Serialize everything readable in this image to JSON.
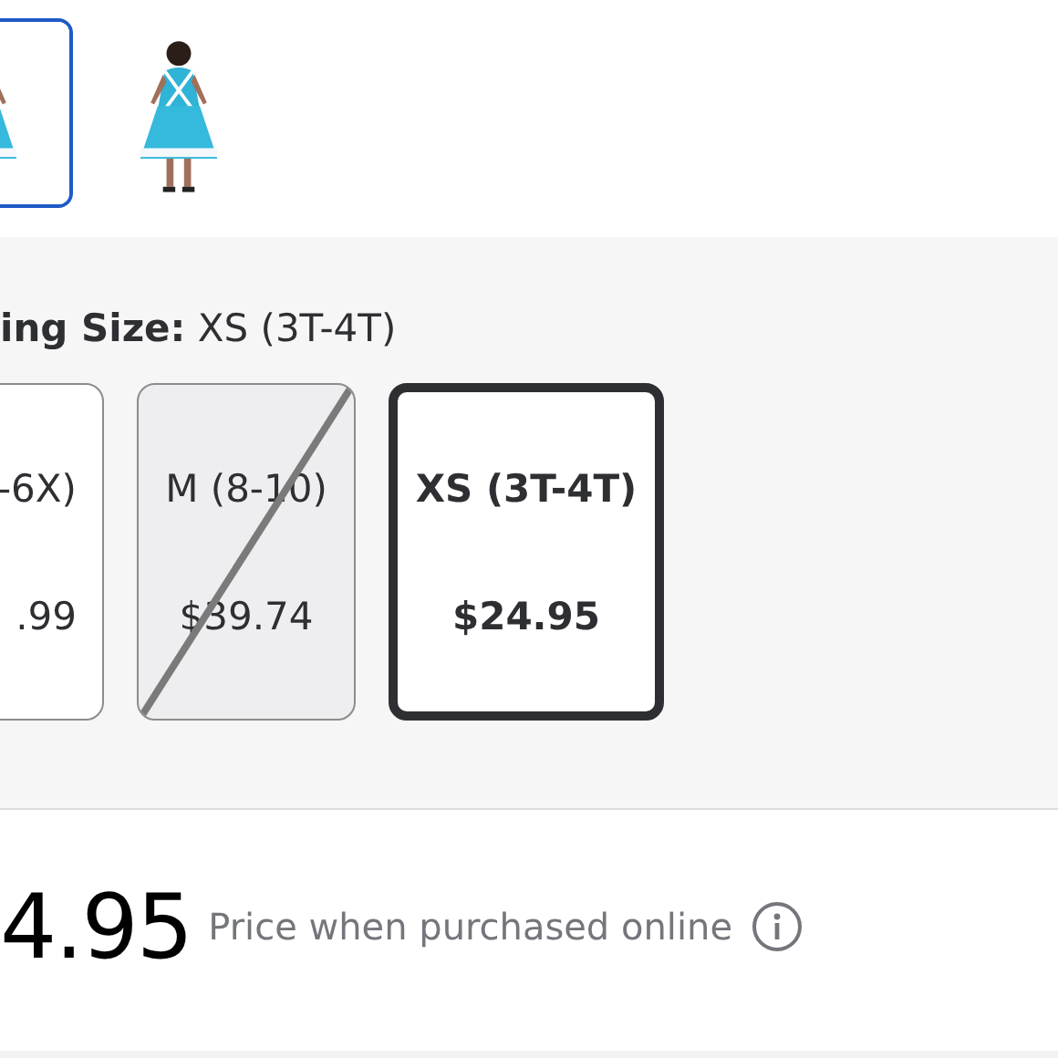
{
  "thumbnails": [
    {
      "kind": "picture",
      "selected": true
    },
    {
      "kind": "picture",
      "selected": false
    }
  ],
  "size_selector": {
    "label": "**ing Size:** XS (3T-4T)",
    "options": [
      {
        "label": "-6X)",
        "price": ".99",
        "selected": false,
        "disabled": false
      },
      {
        "label": "M (8-10)",
        "price": "$39.74",
        "selected": false,
        "disabled": true
      },
      {
        "label": "XS (3T-4T)",
        "price": "$24.95",
        "selected": true,
        "disabled": false
      }
    ]
  },
  "price": {
    "amount": "4.95",
    "note": "Price when purchased online"
  }
}
